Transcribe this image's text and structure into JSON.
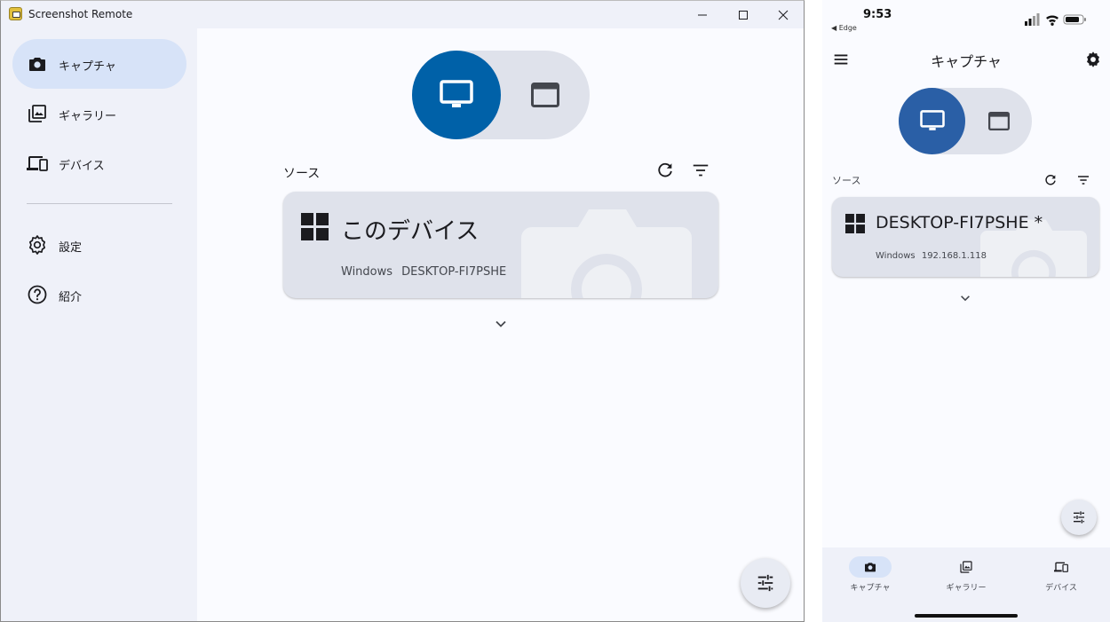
{
  "desktop": {
    "window_title": "Screenshot Remote",
    "sidebar": {
      "items": [
        {
          "label": "キャプチャ",
          "icon": "camera-icon",
          "active": true
        },
        {
          "label": "ギャラリー",
          "icon": "gallery-icon",
          "active": false
        },
        {
          "label": "デバイス",
          "icon": "devices-icon",
          "active": false
        },
        {
          "label": "設定",
          "icon": "gear-icon",
          "active": false
        },
        {
          "label": "紹介",
          "icon": "help-icon",
          "active": false
        }
      ]
    },
    "mode_toggle": {
      "selected": "screen",
      "options": [
        "monitor-icon",
        "window-icon"
      ]
    },
    "source_label": "ソース",
    "device_card": {
      "title": "このデバイス",
      "os": "Windows",
      "hostname": "DESKTOP-FI7PSHE"
    }
  },
  "phone": {
    "status": {
      "time": "9:53",
      "back_app": "◀ Edge"
    },
    "title": "キャプチャ",
    "source_label": "ソース",
    "device_card": {
      "title": "DESKTOP-FI7PSHE *",
      "os": "Windows",
      "ip": "192.168.1.118"
    },
    "bottom_nav": [
      {
        "label": "キャプチャ",
        "icon": "camera-icon",
        "active": true
      },
      {
        "label": "ギャラリー",
        "icon": "gallery-icon",
        "active": false
      },
      {
        "label": "デバイス",
        "icon": "devices-icon",
        "active": false
      }
    ]
  },
  "colors": {
    "accent": "#0061a8",
    "accent_phone": "#2a5fa6",
    "surface": "#eff1f9",
    "card": "#dfe2eb",
    "active_pill": "#d7e3f8"
  }
}
